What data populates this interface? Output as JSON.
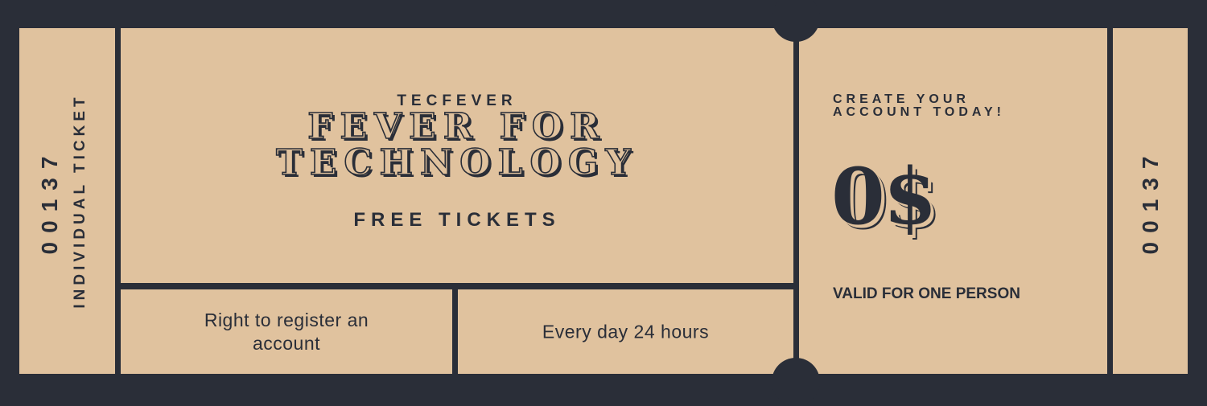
{
  "left_stub": {
    "number": "00137",
    "label": "INDIVIDUAL TICKET"
  },
  "main": {
    "brand": "TECFEVER",
    "headline_line1": "FEVER FOR",
    "headline_line2": "TECHNOLOGY",
    "subheadline": "FREE TICKETS",
    "feature_left": "Right to register an account",
    "feature_right": "Every day 24 hours"
  },
  "right_section": {
    "promo_line1": "CREATE YOUR",
    "promo_line2": "ACCOUNT TODAY!",
    "price": "0$",
    "validity": "VALID FOR ONE PERSON"
  },
  "right_stub": {
    "number": "00137"
  },
  "colors": {
    "background": "#2a2e38",
    "ticket": "#e0c29e",
    "ink": "#2a2e38"
  }
}
